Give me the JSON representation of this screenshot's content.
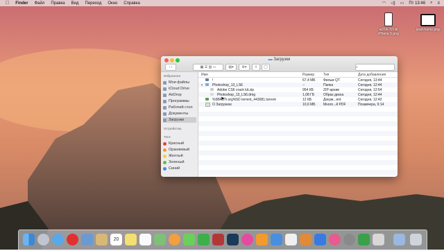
{
  "menubar": {
    "app": "Finder",
    "items": [
      "Файл",
      "Правка",
      "Вид",
      "Переход",
      "Окно",
      "Справка"
    ],
    "clock": "Пт 13:46"
  },
  "desktop_icons": [
    {
      "name": "жЗТА-ТЛ-Ж iPhone 5.png"
    },
    {
      "name": "ipad-frame.png"
    }
  ],
  "window": {
    "title": "Загрузки",
    "sidebar": {
      "favorites_header": "Избранное",
      "favorites": [
        "Мои файлы",
        "iCloud Drive",
        "AirDrop",
        "Программы",
        "Рабочий стол",
        "Документы",
        "Загрузки"
      ],
      "devices_header": "Устройства",
      "tags_header": "Теги",
      "tags": [
        {
          "label": "Красный",
          "color": "#e8423a"
        },
        {
          "label": "Оранжевый",
          "color": "#f29a2e"
        },
        {
          "label": "Желтый",
          "color": "#f2d233"
        },
        {
          "label": "Зеленый",
          "color": "#5cc04a"
        },
        {
          "label": "Синий",
          "color": "#3a8ee8"
        }
      ]
    },
    "columns": {
      "name": "Имя",
      "size": "Размер",
      "kind": "Тип",
      "date": "Дата добавления"
    },
    "rows": [
      {
        "name": "!",
        "size": "67,4 МБ",
        "kind": "Фильм QT",
        "date": "Сегодня, 13:44"
      },
      {
        "name": "Photoshop_13_LS6",
        "size": "--",
        "kind": "Папка",
        "date": "Сегодня, 12:44"
      },
      {
        "name": "Adobe CS6 crack kit.zip",
        "size": "954 КБ",
        "kind": "ZIP-архив",
        "date": "Сегодня, 12:54"
      },
      {
        "name": "Photoshop_13_LS6.dmg",
        "size": "1,08 ГБ",
        "kind": "Образ диска",
        "date": "Сегодня, 12:44"
      },
      {
        "name": "%5BRuTr.org%5D torrent_443081.torrent",
        "size": "12 КБ",
        "kind": "Докум...ent",
        "date": "Сегодня, 12:42"
      },
      {
        "name": "О Загрузках",
        "size": "10,6 МБ",
        "kind": "Много...й PDF",
        "date": "Позавчера, 9:14"
      }
    ]
  },
  "dock": {
    "calendar_day": "20",
    "icons": [
      "finder-icon",
      "launchpad-icon",
      "safari-icon",
      "opera-icon",
      "preview-icon",
      "mail-icon",
      "calendar-icon",
      "notes-icon",
      "reminders-icon",
      "maps-icon",
      "photos-icon",
      "messages-icon",
      "facetime-icon",
      "photobooth-icon",
      "photoshop-icon",
      "itunes-icon",
      "ibooks-icon",
      "keynote-icon",
      "pages-icon",
      "numbers-icon",
      "appstore-icon",
      "itunes2-icon",
      "ibooks2-icon",
      "settings-icon",
      "torrent-icon",
      "app-icon",
      "folder-icon",
      "trash-icon"
    ]
  }
}
